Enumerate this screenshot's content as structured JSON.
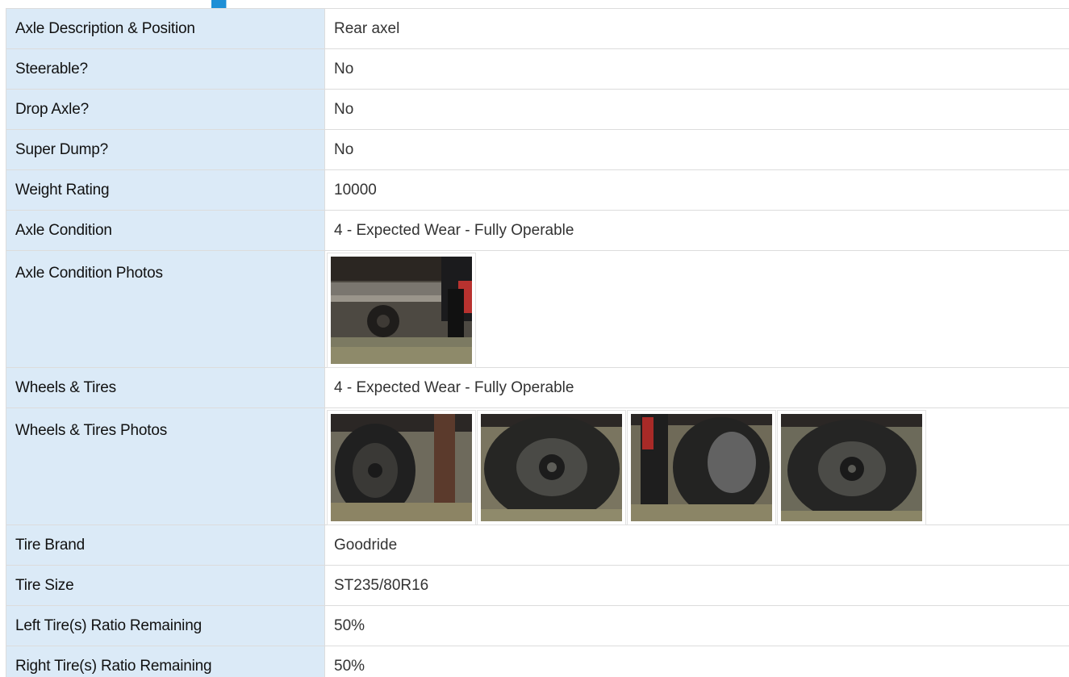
{
  "rows": [
    {
      "label": "Axle Description & Position",
      "value": "Rear axel"
    },
    {
      "label": "Steerable?",
      "value": "No"
    },
    {
      "label": "Drop Axle?",
      "value": "No"
    },
    {
      "label": "Super Dump?",
      "value": "No"
    },
    {
      "label": "Weight Rating",
      "value": "10000"
    },
    {
      "label": "Axle Condition",
      "value": "4 - Expected Wear - Fully Operable"
    }
  ],
  "axle_photos": {
    "label": "Axle Condition Photos",
    "photos": [
      {
        "subject": "trailer underside with rear axle",
        "alt": "Axle condition photo 1"
      }
    ]
  },
  "wheels_row": {
    "label": "Wheels & Tires",
    "value": "4 - Expected Wear - Fully Operable"
  },
  "wheel_photos": {
    "label": "Wheels & Tires Photos",
    "photos": [
      {
        "subject": "dual tires with mud flap",
        "alt": "Wheels photo 1"
      },
      {
        "subject": "close-up of tire and wheel hub",
        "alt": "Wheels photo 2"
      },
      {
        "subject": "tire behind red mud flap",
        "alt": "Wheels photo 3"
      },
      {
        "subject": "close-up of tire and wheel hub",
        "alt": "Wheels photo 4"
      }
    ]
  },
  "tire_rows": [
    {
      "label": "Tire Brand",
      "value": "Goodride"
    },
    {
      "label": "Tire Size",
      "value": "ST235/80R16"
    },
    {
      "label": "Left Tire(s) Ratio Remaining",
      "value": "50%"
    },
    {
      "label": "Right Tire(s) Ratio Remaining",
      "value": "50%"
    }
  ],
  "colors": {
    "label_bg": "#dbeaf7",
    "border": "#dcdcdc",
    "accent": "#1e8fd6"
  }
}
